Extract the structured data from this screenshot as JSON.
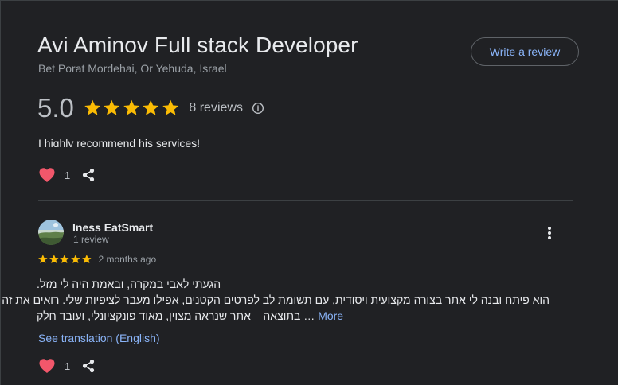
{
  "business": {
    "name": "Avi Aminov Full stack Developer",
    "address": "Bet Porat Mordehai, Or Yehuda, Israel"
  },
  "write_review_label": "Write a review",
  "rating": {
    "value": "5.0",
    "stars": 5,
    "reviews_label": "8 reviews",
    "star_color": "#fbbc04"
  },
  "prev_review": {
    "clipped_text": "I highly recommend his services!",
    "reaction_count": "1"
  },
  "review": {
    "author": "Iness EatSmart",
    "author_meta": "1 review",
    "stars": 5,
    "date": "2 months ago",
    "lines": [
      "הגעתי לאבי במקרה, ובאמת היה לי מזל.",
      "הוא פיתח ובנה לי אתר בצורה מקצועית ויסודית, עם תשומת לב לפרטים הקטנים, אפילו מעבר לציפיות שלי. רואים את זה",
      "בתוצאה – אתר שנראה מצוין, מאוד פונקציונלי, ועובד חלק"
    ],
    "ellipsis": "…",
    "more_label": "More",
    "translation_label": "See translation (English)",
    "reaction_count": "1"
  },
  "colors": {
    "background": "#202124",
    "link": "#8ab4f8",
    "heart": "#f2576b"
  }
}
